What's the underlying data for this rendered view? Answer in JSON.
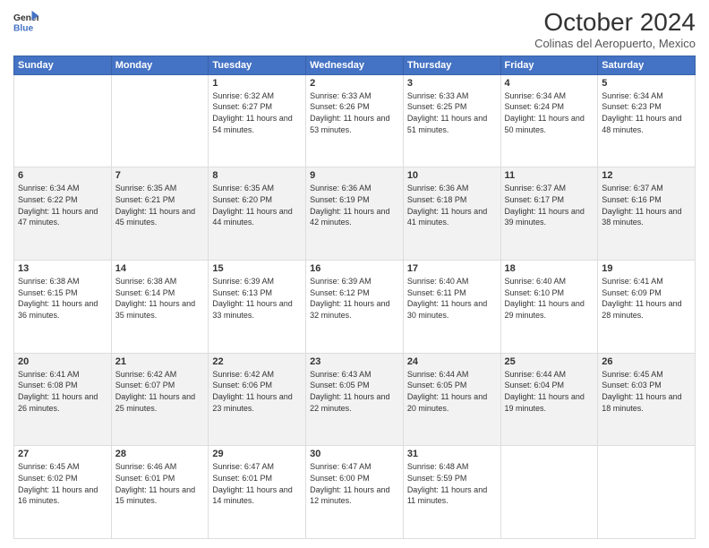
{
  "header": {
    "logo": {
      "line1": "General",
      "line2": "Blue"
    },
    "title": "October 2024",
    "subtitle": "Colinas del Aeropuerto, Mexico"
  },
  "weekdays": [
    "Sunday",
    "Monday",
    "Tuesday",
    "Wednesday",
    "Thursday",
    "Friday",
    "Saturday"
  ],
  "weeks": [
    [
      {
        "day": "",
        "sunrise": "",
        "sunset": "",
        "daylight": ""
      },
      {
        "day": "",
        "sunrise": "",
        "sunset": "",
        "daylight": ""
      },
      {
        "day": "1",
        "sunrise": "Sunrise: 6:32 AM",
        "sunset": "Sunset: 6:27 PM",
        "daylight": "Daylight: 11 hours and 54 minutes."
      },
      {
        "day": "2",
        "sunrise": "Sunrise: 6:33 AM",
        "sunset": "Sunset: 6:26 PM",
        "daylight": "Daylight: 11 hours and 53 minutes."
      },
      {
        "day": "3",
        "sunrise": "Sunrise: 6:33 AM",
        "sunset": "Sunset: 6:25 PM",
        "daylight": "Daylight: 11 hours and 51 minutes."
      },
      {
        "day": "4",
        "sunrise": "Sunrise: 6:34 AM",
        "sunset": "Sunset: 6:24 PM",
        "daylight": "Daylight: 11 hours and 50 minutes."
      },
      {
        "day": "5",
        "sunrise": "Sunrise: 6:34 AM",
        "sunset": "Sunset: 6:23 PM",
        "daylight": "Daylight: 11 hours and 48 minutes."
      }
    ],
    [
      {
        "day": "6",
        "sunrise": "Sunrise: 6:34 AM",
        "sunset": "Sunset: 6:22 PM",
        "daylight": "Daylight: 11 hours and 47 minutes."
      },
      {
        "day": "7",
        "sunrise": "Sunrise: 6:35 AM",
        "sunset": "Sunset: 6:21 PM",
        "daylight": "Daylight: 11 hours and 45 minutes."
      },
      {
        "day": "8",
        "sunrise": "Sunrise: 6:35 AM",
        "sunset": "Sunset: 6:20 PM",
        "daylight": "Daylight: 11 hours and 44 minutes."
      },
      {
        "day": "9",
        "sunrise": "Sunrise: 6:36 AM",
        "sunset": "Sunset: 6:19 PM",
        "daylight": "Daylight: 11 hours and 42 minutes."
      },
      {
        "day": "10",
        "sunrise": "Sunrise: 6:36 AM",
        "sunset": "Sunset: 6:18 PM",
        "daylight": "Daylight: 11 hours and 41 minutes."
      },
      {
        "day": "11",
        "sunrise": "Sunrise: 6:37 AM",
        "sunset": "Sunset: 6:17 PM",
        "daylight": "Daylight: 11 hours and 39 minutes."
      },
      {
        "day": "12",
        "sunrise": "Sunrise: 6:37 AM",
        "sunset": "Sunset: 6:16 PM",
        "daylight": "Daylight: 11 hours and 38 minutes."
      }
    ],
    [
      {
        "day": "13",
        "sunrise": "Sunrise: 6:38 AM",
        "sunset": "Sunset: 6:15 PM",
        "daylight": "Daylight: 11 hours and 36 minutes."
      },
      {
        "day": "14",
        "sunrise": "Sunrise: 6:38 AM",
        "sunset": "Sunset: 6:14 PM",
        "daylight": "Daylight: 11 hours and 35 minutes."
      },
      {
        "day": "15",
        "sunrise": "Sunrise: 6:39 AM",
        "sunset": "Sunset: 6:13 PM",
        "daylight": "Daylight: 11 hours and 33 minutes."
      },
      {
        "day": "16",
        "sunrise": "Sunrise: 6:39 AM",
        "sunset": "Sunset: 6:12 PM",
        "daylight": "Daylight: 11 hours and 32 minutes."
      },
      {
        "day": "17",
        "sunrise": "Sunrise: 6:40 AM",
        "sunset": "Sunset: 6:11 PM",
        "daylight": "Daylight: 11 hours and 30 minutes."
      },
      {
        "day": "18",
        "sunrise": "Sunrise: 6:40 AM",
        "sunset": "Sunset: 6:10 PM",
        "daylight": "Daylight: 11 hours and 29 minutes."
      },
      {
        "day": "19",
        "sunrise": "Sunrise: 6:41 AM",
        "sunset": "Sunset: 6:09 PM",
        "daylight": "Daylight: 11 hours and 28 minutes."
      }
    ],
    [
      {
        "day": "20",
        "sunrise": "Sunrise: 6:41 AM",
        "sunset": "Sunset: 6:08 PM",
        "daylight": "Daylight: 11 hours and 26 minutes."
      },
      {
        "day": "21",
        "sunrise": "Sunrise: 6:42 AM",
        "sunset": "Sunset: 6:07 PM",
        "daylight": "Daylight: 11 hours and 25 minutes."
      },
      {
        "day": "22",
        "sunrise": "Sunrise: 6:42 AM",
        "sunset": "Sunset: 6:06 PM",
        "daylight": "Daylight: 11 hours and 23 minutes."
      },
      {
        "day": "23",
        "sunrise": "Sunrise: 6:43 AM",
        "sunset": "Sunset: 6:05 PM",
        "daylight": "Daylight: 11 hours and 22 minutes."
      },
      {
        "day": "24",
        "sunrise": "Sunrise: 6:44 AM",
        "sunset": "Sunset: 6:05 PM",
        "daylight": "Daylight: 11 hours and 20 minutes."
      },
      {
        "day": "25",
        "sunrise": "Sunrise: 6:44 AM",
        "sunset": "Sunset: 6:04 PM",
        "daylight": "Daylight: 11 hours and 19 minutes."
      },
      {
        "day": "26",
        "sunrise": "Sunrise: 6:45 AM",
        "sunset": "Sunset: 6:03 PM",
        "daylight": "Daylight: 11 hours and 18 minutes."
      }
    ],
    [
      {
        "day": "27",
        "sunrise": "Sunrise: 6:45 AM",
        "sunset": "Sunset: 6:02 PM",
        "daylight": "Daylight: 11 hours and 16 minutes."
      },
      {
        "day": "28",
        "sunrise": "Sunrise: 6:46 AM",
        "sunset": "Sunset: 6:01 PM",
        "daylight": "Daylight: 11 hours and 15 minutes."
      },
      {
        "day": "29",
        "sunrise": "Sunrise: 6:47 AM",
        "sunset": "Sunset: 6:01 PM",
        "daylight": "Daylight: 11 hours and 14 minutes."
      },
      {
        "day": "30",
        "sunrise": "Sunrise: 6:47 AM",
        "sunset": "Sunset: 6:00 PM",
        "daylight": "Daylight: 11 hours and 12 minutes."
      },
      {
        "day": "31",
        "sunrise": "Sunrise: 6:48 AM",
        "sunset": "Sunset: 5:59 PM",
        "daylight": "Daylight: 11 hours and 11 minutes."
      },
      {
        "day": "",
        "sunrise": "",
        "sunset": "",
        "daylight": ""
      },
      {
        "day": "",
        "sunrise": "",
        "sunset": "",
        "daylight": ""
      }
    ]
  ]
}
